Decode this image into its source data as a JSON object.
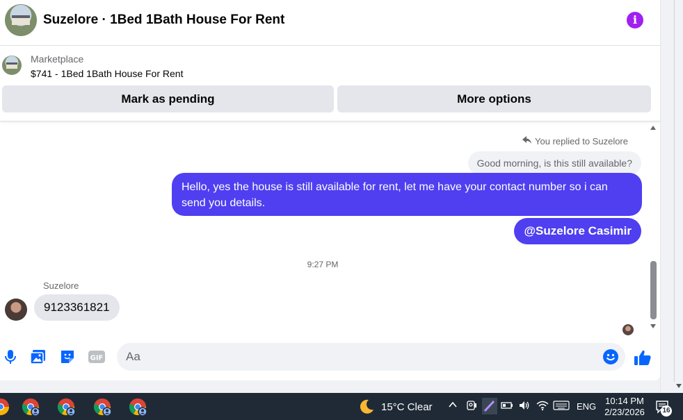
{
  "header": {
    "title": "Suzelore · 1Bed 1Bath House For Rent",
    "info_icon": "info-icon",
    "info_color": "#a020f0"
  },
  "marketplace": {
    "label": "Marketplace",
    "listing": "$741 - 1Bed 1Bath House For Rent",
    "buttons": {
      "pending": "Mark as pending",
      "more": "More options"
    }
  },
  "conversation": {
    "replied_note": "You replied to Suzelore",
    "quoted_message": "Good morning, is this still available?",
    "outgoing_message": "Hello, yes the house is still available for rent, let me have your contact number so i can send you details.",
    "mention": "@Suzelore Casimir",
    "timestamp": "9:27 PM",
    "sender_name": "Suzelore",
    "incoming_message": "9123361821",
    "outgoing_color": "#4f3ff0"
  },
  "composer": {
    "placeholder": "Aa",
    "icons": [
      "microphone-icon",
      "photo-icon",
      "sticker-icon",
      "gif-icon",
      "emoji-icon",
      "like-icon"
    ],
    "accent_color": "#0866ff"
  },
  "taskbar": {
    "weather": "15°C  Clear",
    "language": "ENG",
    "time": "10:14 PM",
    "date": "2/23/2026",
    "notification_count": "16",
    "background": "#1f2a36"
  }
}
